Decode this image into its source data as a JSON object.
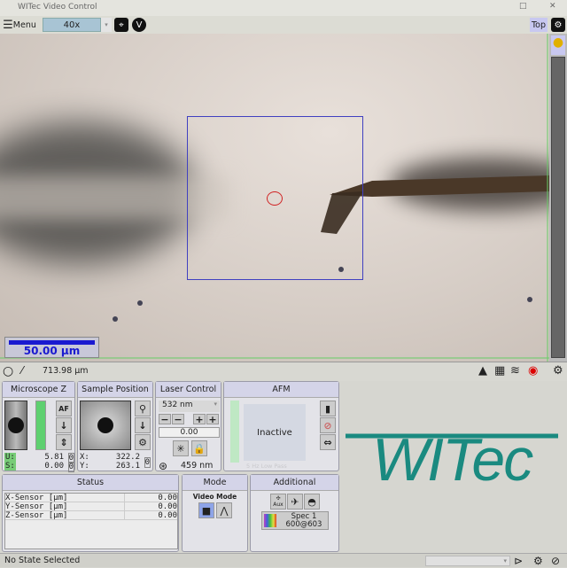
{
  "window": {
    "title": "WITec Video Control",
    "maximize_icon": "□",
    "close_icon": "✕"
  },
  "toolbar": {
    "menu_label": "Menu",
    "objective": "40x",
    "top_label": "Top"
  },
  "video": {
    "scale_bar_label": "50.00 µm",
    "roi_color": "#4040c0",
    "marker_color": "#d02020"
  },
  "bottombar": {
    "field_width": "713.98 µm"
  },
  "microscope_z": {
    "title": "Microscope Z",
    "af_label": "AF",
    "u_label": "U:",
    "u_value": "5.81",
    "s_label": "S:",
    "s_value": "0.00",
    "zero": "0"
  },
  "sample_position": {
    "title": "Sample Position",
    "x_label": "X:",
    "x_value": "322.2",
    "y_label": "Y:",
    "y_value": "263.1",
    "zero": "0"
  },
  "laser_control": {
    "title": "Laser Control",
    "wavelength": "532 nm",
    "power": "0.00",
    "spot_size": "459 nm"
  },
  "afm": {
    "title": "AFM",
    "state": "Inactive",
    "filter": "5 Hz Low Pass"
  },
  "status": {
    "title": "Status",
    "rows": [
      {
        "name": "X-Sensor [µm]",
        "value": "0.00"
      },
      {
        "name": "Y-Sensor [µm]",
        "value": "0.00"
      },
      {
        "name": "Z-Sensor [µm]",
        "value": "0.00"
      }
    ]
  },
  "mode": {
    "title": "Mode",
    "label": "Video Mode"
  },
  "additional": {
    "title": "Additional",
    "aux_label": "Aux",
    "spec_name": "Spec 1",
    "spec_grating": "600@603"
  },
  "logo": {
    "text": "WITec",
    "color": "#1a8a80"
  },
  "statusbar": {
    "state": "No State Selected"
  }
}
